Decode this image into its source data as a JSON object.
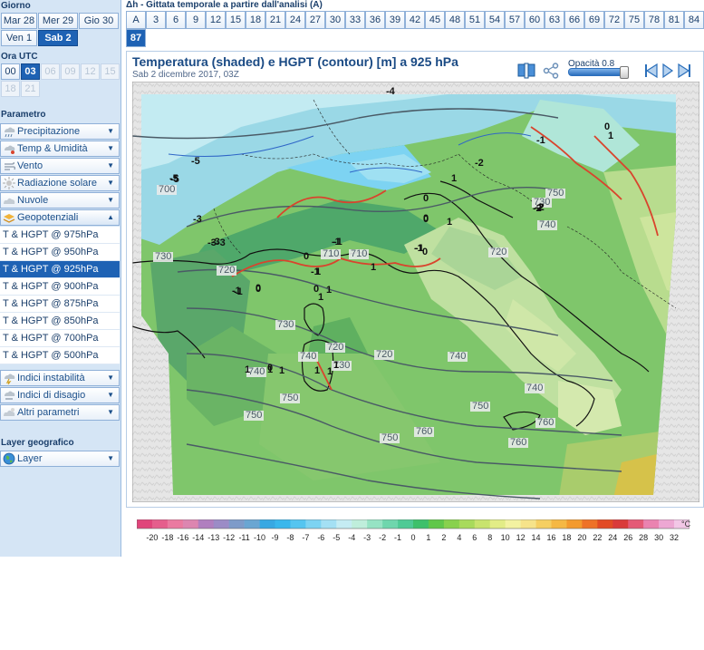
{
  "days": {
    "section_title": "Giorno",
    "items": [
      {
        "label": "Mar 28",
        "selected": false
      },
      {
        "label": "Mer 29",
        "selected": false
      },
      {
        "label": "Gio 30",
        "selected": false
      },
      {
        "label": "Ven 1",
        "selected": false
      },
      {
        "label": "Sab 2",
        "selected": true
      }
    ]
  },
  "hours": {
    "section_title": "Ora UTC",
    "items": [
      {
        "label": "00",
        "state": "normal"
      },
      {
        "label": "03",
        "state": "selected"
      },
      {
        "label": "06",
        "state": "disabled"
      },
      {
        "label": "09",
        "state": "disabled"
      },
      {
        "label": "12",
        "state": "disabled"
      },
      {
        "label": "15",
        "state": "disabled"
      },
      {
        "label": "18",
        "state": "disabled"
      },
      {
        "label": "21",
        "state": "disabled"
      }
    ]
  },
  "parameters": {
    "section_title": "Parametro",
    "categories": [
      {
        "label": "Precipitazione",
        "icon": "rain-cloud-icon"
      },
      {
        "label": "Temp & Umidità",
        "icon": "thermometer-icon"
      },
      {
        "label": "Vento",
        "icon": "wind-icon"
      },
      {
        "label": "Radiazione solare",
        "icon": "sun-icon"
      },
      {
        "label": "Nuvole",
        "icon": "cloud-icon"
      },
      {
        "label": "Geopotenziali",
        "icon": "layers-icon",
        "open": true
      }
    ],
    "geopotential_items": [
      {
        "label": "T & HGPT @ 975hPa",
        "selected": false
      },
      {
        "label": "T & HGPT @ 950hPa",
        "selected": false
      },
      {
        "label": "T & HGPT @ 925hPa",
        "selected": true
      },
      {
        "label": "T & HGPT @ 900hPa",
        "selected": false
      },
      {
        "label": "T & HGPT @ 875hPa",
        "selected": false
      },
      {
        "label": "T & HGPT @ 850hPa",
        "selected": false
      },
      {
        "label": "T & HGPT @ 700hPa",
        "selected": false
      },
      {
        "label": "T & HGPT @ 500hPa",
        "selected": false
      }
    ],
    "more_categories": [
      {
        "label": "Indici instabilità",
        "icon": "storm-icon"
      },
      {
        "label": "Indici di disagio",
        "icon": "discomfort-icon"
      },
      {
        "label": "Altri parametri",
        "icon": "misc-cloud-icon"
      }
    ]
  },
  "geo_layer": {
    "section_title": "Layer geografico",
    "label": "Layer",
    "icon": "globe-icon"
  },
  "forecast_range": {
    "title": "Δh - Gittata temporale a partire dall'analisi (A)",
    "items": [
      "A",
      "3",
      "6",
      "9",
      "12",
      "15",
      "18",
      "21",
      "24",
      "27",
      "30",
      "33",
      "36",
      "39",
      "42",
      "45",
      "48",
      "51",
      "54",
      "57",
      "60",
      "63",
      "66",
      "69",
      "72",
      "75",
      "78",
      "81",
      "84",
      "87"
    ],
    "selected": "87"
  },
  "map_panel": {
    "title": "Temperatura (shaded) e HGPT (contour) [m] a 925 hPa",
    "date": "Sab 2 dicembre 2017, 03Z",
    "opacity_label": "Opacità 0.8",
    "opacity_value": 0.8,
    "controls": [
      "book-icon",
      "share-icon",
      "prev-icon",
      "play-icon",
      "next-icon"
    ]
  },
  "map_labels": {
    "contours": [
      "770",
      "760",
      "750",
      "740",
      "730",
      "720",
      "710",
      "700",
      "780",
      "760",
      "750",
      "740",
      "730",
      "720",
      "710",
      "720",
      "730",
      "740",
      "750",
      "760",
      "750",
      "760",
      "740",
      "730",
      "740",
      "750",
      "770",
      "760",
      "750",
      "710",
      "740",
      "730",
      "720"
    ],
    "temps": [
      "-4",
      "-5",
      "-5",
      "-3",
      "-3",
      "-2",
      "-2",
      "-1",
      "-1",
      "-1",
      "-1",
      "-1",
      "0",
      "0",
      "0",
      "0",
      "0",
      "1",
      "1",
      "1",
      "1",
      "1",
      "1",
      "1",
      "1",
      "-3",
      "-5",
      "-3",
      "-2",
      "-1",
      "0",
      "1",
      "1",
      "1",
      "1",
      "0",
      "-2",
      "-1",
      "0",
      "-1",
      "0",
      "0",
      "1"
    ]
  },
  "legend": {
    "unit": "°C",
    "ticks": [
      "-20",
      "-18",
      "-16",
      "-14",
      "-13",
      "-12",
      "-11",
      "-10",
      "-9",
      "-8",
      "-7",
      "-6",
      "-5",
      "-4",
      "-3",
      "-2",
      "-1",
      "0",
      "1",
      "2",
      "4",
      "6",
      "8",
      "10",
      "12",
      "14",
      "16",
      "18",
      "20",
      "22",
      "24",
      "26",
      "28",
      "30",
      "32"
    ],
    "colors": [
      "#e0457b",
      "#e55e8c",
      "#ea7aa0",
      "#dc86b0",
      "#b07fbf",
      "#9b8cc6",
      "#7e9bc9",
      "#6aa6d2",
      "#38a8e2",
      "#3ab7ec",
      "#55c5f0",
      "#7dd3f2",
      "#a4e0f4",
      "#c5ecf3",
      "#bfeedb",
      "#96e3c4",
      "#6fd6ad",
      "#4fca95",
      "#3ec06b",
      "#60c74a",
      "#88d14d",
      "#a8da5c",
      "#c8e36e",
      "#e2ec86",
      "#f3f2a1",
      "#f6e38a",
      "#f5cf62",
      "#f5b844",
      "#f39a2e",
      "#ee7228",
      "#e24b25",
      "#d93a3a",
      "#e45a76",
      "#ea83b0",
      "#eda7d3",
      "#f2c7e6"
    ]
  }
}
